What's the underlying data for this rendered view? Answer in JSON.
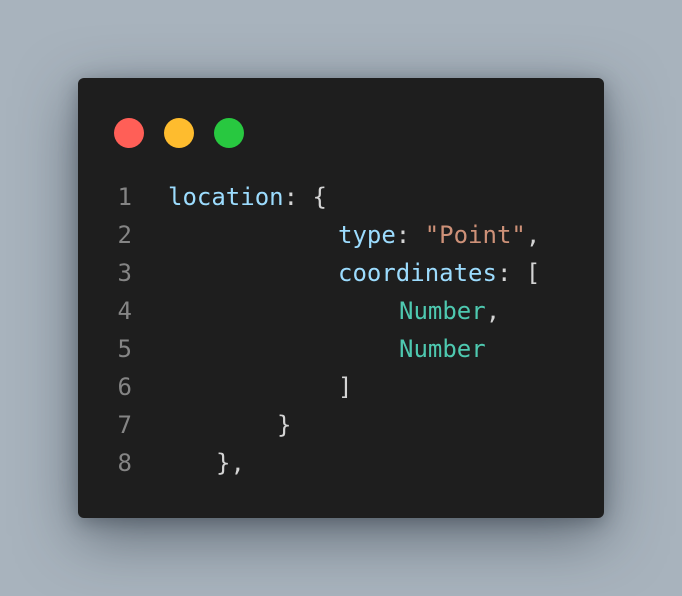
{
  "window": {
    "dots": [
      {
        "name": "close",
        "color": "#ff5f57"
      },
      {
        "name": "minimize",
        "color": "#febc2e"
      },
      {
        "name": "maximize",
        "color": "#28c840"
      }
    ]
  },
  "code": {
    "line_numbers": [
      "1",
      "2",
      "3",
      "4",
      "5",
      "6",
      "7",
      "8"
    ],
    "lines": [
      {
        "key": "location",
        "colon": ": ",
        "open": "{"
      },
      {
        "key": "type",
        "colon": ": ",
        "value": "\"Point\"",
        "trail": ","
      },
      {
        "key": "coordinates",
        "colon": ": ",
        "open": "["
      },
      {
        "type": "Number",
        "trail": ","
      },
      {
        "type": "Number"
      },
      {
        "close": "]"
      },
      {
        "close": "}"
      },
      {
        "close": "},"
      }
    ]
  },
  "colors": {
    "background": "#a8b3bd",
    "editor": "#1e1e1e",
    "key": "#9cdcfe",
    "string": "#ce9178",
    "type": "#4ec9b0",
    "punctuation": "#d4d4d4",
    "line_number": "#858585"
  }
}
